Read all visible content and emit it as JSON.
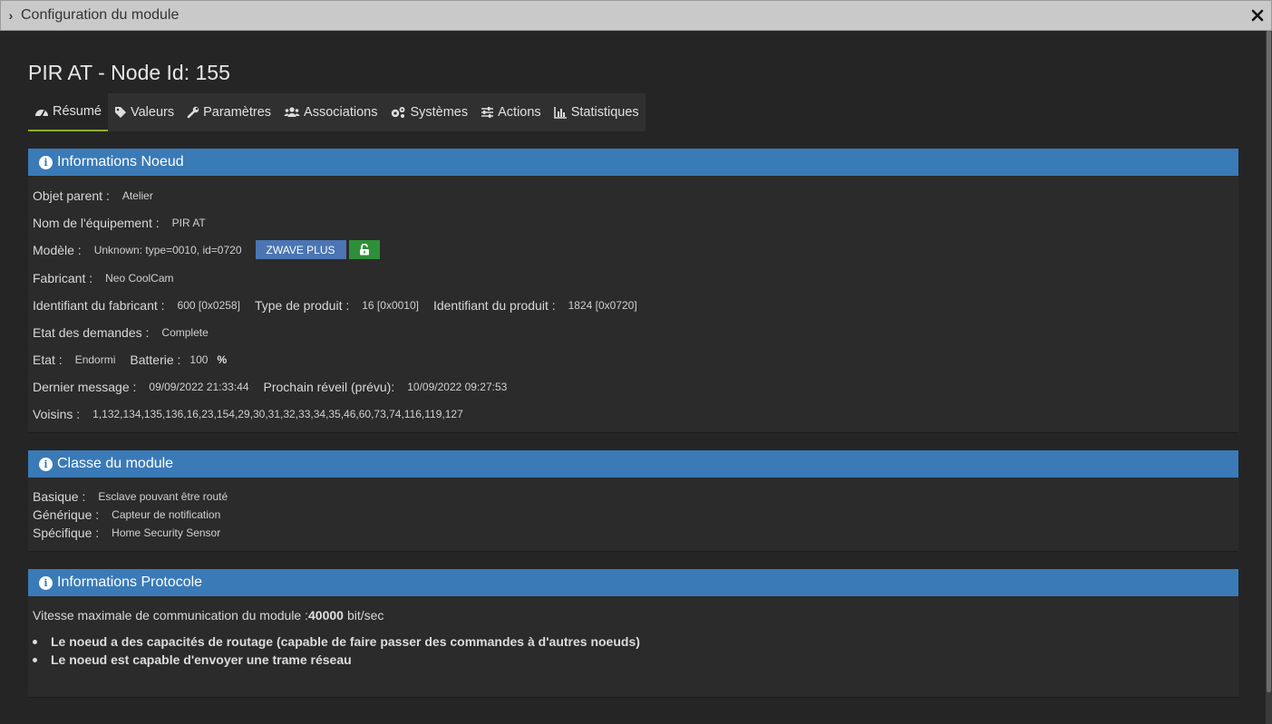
{
  "window": {
    "title": "Configuration du module",
    "chevron": "›",
    "close": "✕"
  },
  "page_title": "PIR AT - Node Id: 155",
  "tabs": [
    {
      "label": "Résumé",
      "icon": "dashboard-icon",
      "active": true
    },
    {
      "label": "Valeurs",
      "icon": "tag-icon"
    },
    {
      "label": "Paramètres",
      "icon": "wrench-icon"
    },
    {
      "label": "Associations",
      "icon": "users-icon"
    },
    {
      "label": "Systèmes",
      "icon": "cogs-icon"
    },
    {
      "label": "Actions",
      "icon": "sliders-icon"
    },
    {
      "label": "Statistiques",
      "icon": "bar-chart-icon"
    }
  ],
  "node_info": {
    "title": "Informations Noeud",
    "objet_parent": {
      "label": "Objet parent :",
      "value": "Atelier"
    },
    "nom_equipement": {
      "label": "Nom de l'équipement :",
      "value": "PIR AT"
    },
    "modele": {
      "label": "Modèle :",
      "value": "Unknown: type=0010, id=0720",
      "badge": "ZWAVE PLUS"
    },
    "fabricant": {
      "label": "Fabricant :",
      "value": "Neo CoolCam"
    },
    "identifiant_fabricant": {
      "label": "Identifiant du fabricant :",
      "value": "600 [0x0258]"
    },
    "type_produit": {
      "label": "Type de produit :",
      "value": "16 [0x0010]"
    },
    "identifiant_produit": {
      "label": "Identifiant du produit :",
      "value": "1824 [0x0720]"
    },
    "etat_demandes": {
      "label": "Etat des demandes :",
      "value": "Complete"
    },
    "etat": {
      "label": "Etat :",
      "value": "Endormi"
    },
    "batterie": {
      "label": "Batterie :",
      "value": "100",
      "unit": "%"
    },
    "dernier_message": {
      "label": "Dernier message :",
      "value": "09/09/2022 21:33:44"
    },
    "prochain_reveil": {
      "label": "Prochain réveil (prévu):",
      "value": "10/09/2022 09:27:53"
    },
    "voisins": {
      "label": "Voisins :",
      "value": "1,132,134,135,136,16,23,154,29,30,31,32,33,34,35,46,60,73,74,116,119,127"
    }
  },
  "module_class": {
    "title": "Classe du module",
    "basique": {
      "label": "Basique :",
      "value": "Esclave pouvant être routé"
    },
    "generique": {
      "label": "Générique :",
      "value": "Capteur de notification"
    },
    "specifique": {
      "label": "Spécifique :",
      "value": "Home Security Sensor"
    }
  },
  "protocol": {
    "title": "Informations Protocole",
    "speed_label": "Vitesse maximale de communication du module :",
    "speed_value": "40000",
    "speed_unit": "bit/sec",
    "capabilities": [
      "Le noeud a des capacités de routage (capable de faire passer des commandes à d'autres noeuds)",
      "Le noeud est capable d'envoyer une trame réseau"
    ]
  },
  "colors": {
    "panel_header": "#3a7ab7",
    "active_tab_underline": "#8bb21c",
    "badge_blue": "#4b75b3",
    "badge_green": "#2e8f3a"
  }
}
